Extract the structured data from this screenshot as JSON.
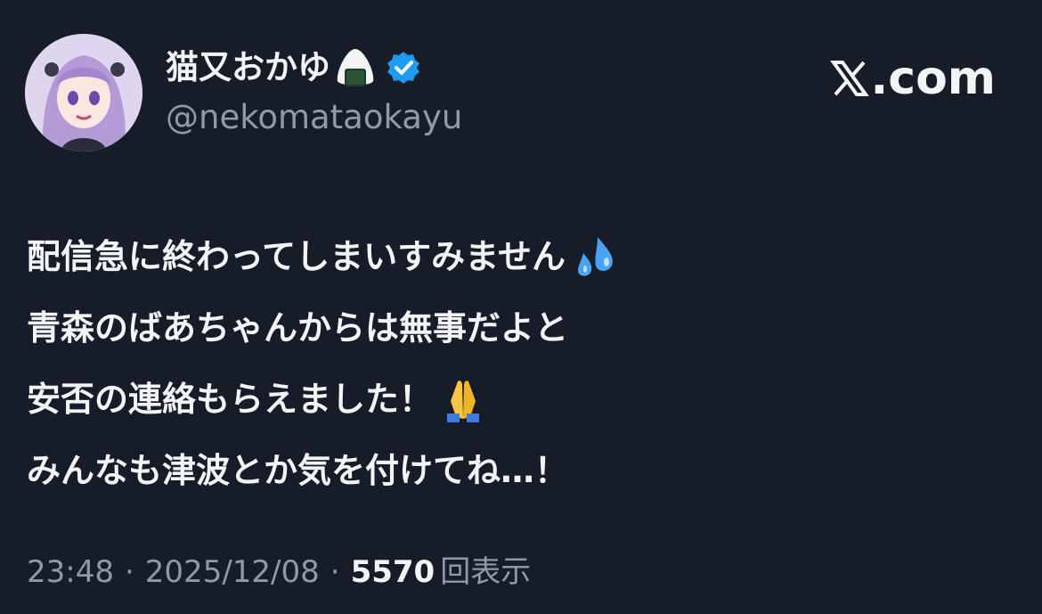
{
  "post": {
    "display_name": "猫又おかゆ",
    "name_emoji": "onigiri-icon",
    "verified": true,
    "handle": "@nekomataokayu",
    "body_lines": [
      "配信急に終わってしまいすみません",
      "青森のばあちゃんからは無事だよと",
      "安否の連絡もらえました！",
      "みんなも津波とか気を付けてね…！"
    ],
    "body_emojis": [
      "sweat-droplets-icon",
      "",
      "folded-hands-icon",
      ""
    ],
    "time": "23:48",
    "date": "2025/12/08",
    "separator": "·",
    "views_count": "5570",
    "views_label": "回表示"
  },
  "brand": {
    "label": ".com"
  },
  "colors": {
    "background": "#161d28",
    "text": "#f2f4f6",
    "muted": "#8e9aa7",
    "verified": "#1d9bf0"
  }
}
